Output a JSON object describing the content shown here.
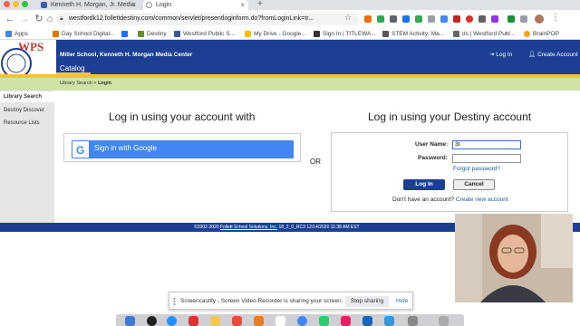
{
  "browser": {
    "tabs": [
      {
        "label": "Kenneth H. Morgan, Jr. Media"
      },
      {
        "label": "Login"
      }
    ],
    "new_tab": "+",
    "url": "westfordk12.follettdestiny.com/common/servlet/presentloginform.do?fromLoginLink=tr...",
    "bookmarks": [
      {
        "label": "Apps"
      },
      {
        "label": "Day School Digital..."
      },
      {
        "label": ""
      },
      {
        "label": "Destiny"
      },
      {
        "label": "Westford Public S..."
      },
      {
        "label": "My Drive - Google..."
      },
      {
        "label": "Sign In | TITLEWA..."
      },
      {
        "label": "STEM Activity: Ma..."
      },
      {
        "label": "ds | Westford Publ..."
      },
      {
        "label": "BrainPOP"
      }
    ]
  },
  "header": {
    "logo_text": "WPS",
    "school_name": "Miller School, Kenneth H. Morgan Media Center",
    "catalog_tab": "Catalog",
    "login_link": "Log In",
    "create_account_link": "Create Account"
  },
  "breadcrumb": {
    "parent": "Library Search",
    "sep": " > ",
    "current": "Login"
  },
  "sidebar": {
    "items": [
      {
        "label": "Library Search"
      },
      {
        "label": "Destiny Discover"
      },
      {
        "label": "Resource Lists"
      }
    ]
  },
  "login": {
    "left_heading": "Log in using your account with",
    "google_button": "Sign in with Google",
    "or_label": "OR",
    "right_heading": "Log in using your Destiny account",
    "username_label": "User Name:",
    "username_value": "3t",
    "password_label": "Password:",
    "password_value": "",
    "forgot_link": "Forgot password?",
    "login_button": "Log In",
    "cancel_button": "Cancel",
    "no_account_text": "Don't have an account?",
    "create_account_link": "Create new account"
  },
  "footer": {
    "copyright": "©2002-2020 ",
    "company": "Follett School Solutions, Inc.",
    "version_info": "   18_2_0_RC3    12/14/2020 11:38 AM EST"
  },
  "screencastify": {
    "message": "Screencastify - Screen Video Recorder is sharing your screen.",
    "stop_button": "Stop sharing",
    "hide_button": "Hide"
  },
  "colors": {
    "header_blue": "#1c3f94",
    "gold": "#f6c42a",
    "breadcrumb_green": "#cfe3a6",
    "google_blue": "#4285f4",
    "link_blue": "#1a5aa6"
  }
}
